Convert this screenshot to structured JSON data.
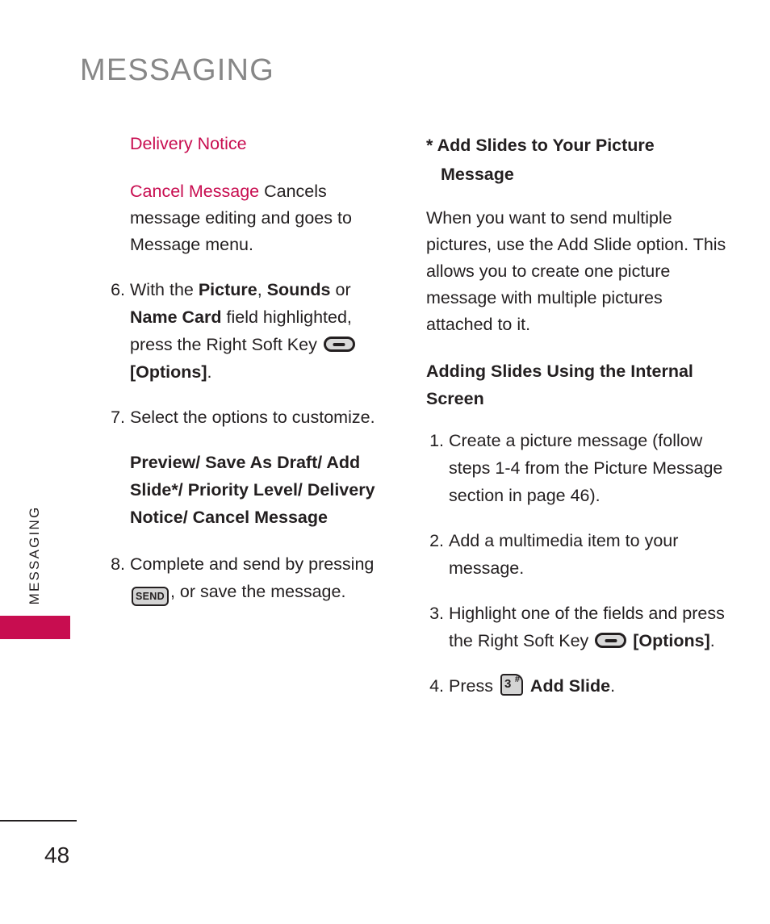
{
  "page": {
    "title": "MESSAGING",
    "side_tab_label": "MESSAGING",
    "number": "48",
    "accent_color": "#c80d50",
    "title_color": "#878787",
    "text_color": "#231f20"
  },
  "left_column": {
    "magenta_heading": "Delivery Notice",
    "definition": {
      "term": "Cancel Message",
      "text": " Cancels message editing and goes to Message menu."
    },
    "step6": {
      "number": "6.",
      "text_a": "With the ",
      "bold_a": "Picture",
      "text_b": ", ",
      "bold_b": "Sounds",
      "text_c": " or ",
      "bold_c": "Name Card",
      "text_d": " field highlighted, press the Right Soft Key ",
      "softkey_icon": "right-soft-key",
      "bold_d": "[Options]",
      "text_e": "."
    },
    "step7": {
      "number": "7.",
      "text": "Select the options to customize."
    },
    "options_list": "Preview/ Save As Draft/ Add Slide*/ Priority Level/ Delivery Notice/ Cancel Message",
    "step8": {
      "number": "8.",
      "text_a": "Complete and send by pressing ",
      "send_key_label": "SEND",
      "text_b": ", or save the message."
    }
  },
  "right_column": {
    "star_heading": {
      "marker": "*",
      "text": "Add Slides to Your Picture Message"
    },
    "intro_paragraph": "When you want to send multiple pictures, use the Add Slide option. This allows you to create one picture message with multiple pictures attached to it.",
    "sub_heading": "Adding Slides Using the Internal Screen",
    "step1": {
      "number": "1.",
      "text": "Create a picture message (follow steps 1-4 from the Picture Message section in page 46)."
    },
    "step2": {
      "number": "2.",
      "text": "Add a multimedia item to your message."
    },
    "step3": {
      "number": "3.",
      "text_a": "Highlight one of the fields and press the Right Soft Key ",
      "softkey_icon": "right-soft-key",
      "bold_a": "[Options]",
      "text_b": "."
    },
    "step4": {
      "number": "4.",
      "text_a": "Press ",
      "key_digit": "3",
      "key_symbol": "#",
      "bold_a": "Add Slide",
      "text_b": "."
    }
  }
}
